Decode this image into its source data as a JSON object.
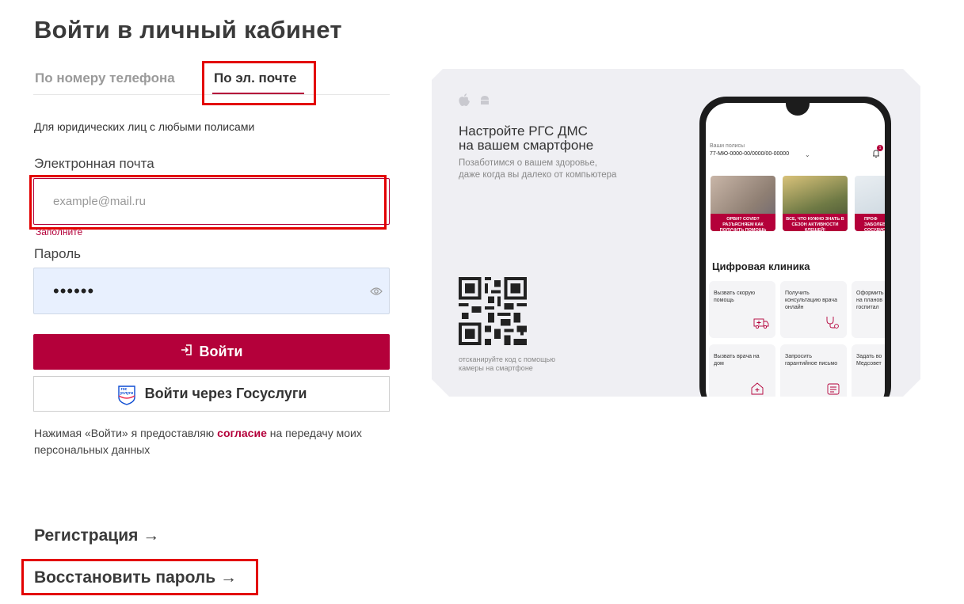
{
  "page": {
    "title": "Войти в личный кабинет"
  },
  "tabs": [
    {
      "label": "По номеру телефона"
    },
    {
      "label": "По эл. почте"
    }
  ],
  "form": {
    "hint": "Для юридических лиц с любыми полисами",
    "email_label": "Электронная почта",
    "email_placeholder": "example@mail.ru",
    "email_error": "Заполните",
    "password_label": "Пароль",
    "password_value": "••••••",
    "login_button": "Войти",
    "gosuslugi_button": "Войти через Госуслуги",
    "gos_logo_text_1": "гос",
    "gos_logo_text_2": "услуги",
    "consent_prefix": "Нажимая «Войти» я предоставляю ",
    "consent_link": "согласие",
    "consent_suffix": " на передачу моих персональных данных"
  },
  "links": {
    "register": "Регистрация →",
    "restore": "Восстановить пароль →"
  },
  "banner": {
    "title_line1": "Настройте РГС ДМС",
    "title_line2": "на вашем смартфоне",
    "subtitle_line1": "Позаботимся о вашем здоровье,",
    "subtitle_line2": "даже когда вы далеко от компьютера",
    "qr_caption_line1": "отсканируйте код с помощью",
    "qr_caption_line2": "камеры на смартфоне",
    "phone": {
      "policies_label": "Ваши полисы",
      "policy_number": "77-МЮ-0000-00/0000/00-00000",
      "notification_count": "1",
      "cards": [
        {
          "caption": "ОРВИ? COVID? РАЗЪЯСНЯЕМ КАК ПОЛУЧИТЬ ПОМОЩЬ"
        },
        {
          "caption": "ВСЕ, ЧТО НУЖНО ЗНАТЬ В СЕЗОН АКТИВНОСТИ КЛЕЩЕЙ!"
        },
        {
          "caption": "ПРОФ ЗАБОЛЕВА СОСУДИСТ"
        }
      ],
      "section_title": "Цифровая клиника",
      "tiles": [
        {
          "label": "Вызвать скорую помощь"
        },
        {
          "label": "Получить консультацию врача онлайн"
        },
        {
          "label": "Оформить на планов госпитал"
        },
        {
          "label": "Вызвать врача на дом"
        },
        {
          "label": "Запросить гарантийное письмо"
        },
        {
          "label": "Задать во Медсовет"
        }
      ]
    }
  },
  "colors": {
    "brand": "#b4003a",
    "highlight": "#e30000",
    "autofill_bg": "#e8f0fe"
  }
}
